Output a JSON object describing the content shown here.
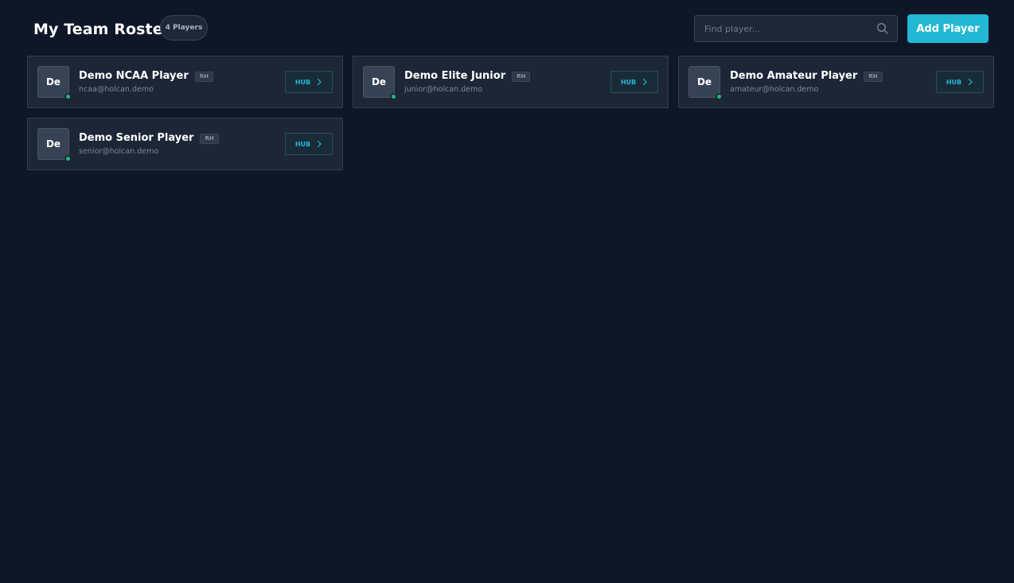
{
  "header": {
    "title": "My Team Roster",
    "count_badge": "4 Players",
    "search_placeholder": "Find player...",
    "add_button": "Add Player"
  },
  "colors": {
    "background": "#0e1628",
    "card": "#1d2636",
    "accent": "#22b8d4",
    "online": "#1fb87a"
  },
  "players": [
    {
      "initials": "De",
      "name": "Demo NCAA Player",
      "hand": "RH",
      "email": "ncaa@holcan.demo",
      "hub_label": "HUB",
      "status": "online"
    },
    {
      "initials": "De",
      "name": "Demo Elite Junior",
      "hand": "RH",
      "email": "junior@holcan.demo",
      "hub_label": "HUB",
      "status": "online"
    },
    {
      "initials": "De",
      "name": "Demo Amateur Player",
      "hand": "RH",
      "email": "amateur@holcan.demo",
      "hub_label": "HUB",
      "status": "online"
    },
    {
      "initials": "De",
      "name": "Demo Senior Player",
      "hand": "RH",
      "email": "senior@holcan.demo",
      "hub_label": "HUB",
      "status": "online"
    }
  ],
  "icons": {
    "search": "search-icon",
    "hub_arrow": "chevron-right-icon",
    "status": "status-dot-icon"
  }
}
